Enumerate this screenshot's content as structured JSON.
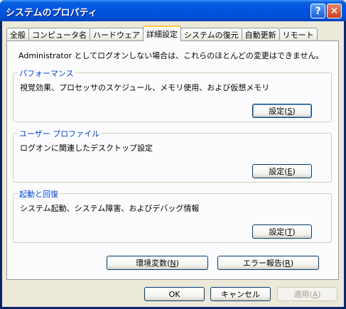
{
  "window": {
    "title": "システムのプロパティ",
    "help_glyph": "?",
    "close_glyph": "✕"
  },
  "tabs": [
    {
      "label": "全般"
    },
    {
      "label": "コンピュータ名"
    },
    {
      "label": "ハードウェア"
    },
    {
      "label": "詳細設定",
      "active": true
    },
    {
      "label": "システムの復元"
    },
    {
      "label": "自動更新"
    },
    {
      "label": "リモート"
    }
  ],
  "panel": {
    "note": "Administrator としてログオンしない場合は、これらのほとんどの変更はできません。",
    "performance": {
      "title": "パフォーマンス",
      "desc": "視覚効果、プロセッサのスケジュール、メモリ使用、および仮想メモリ",
      "button_text": "設定(",
      "button_key": "S",
      "button_close": ")"
    },
    "profile": {
      "title": "ユーザー プロファイル",
      "desc": "ログオンに関連したデスクトップ設定",
      "button_text": "設定(",
      "button_key": "E",
      "button_close": ")"
    },
    "startup": {
      "title": "起動と回復",
      "desc": "システム起動、システム障害、およびデバッグ情報",
      "button_text": "設定(",
      "button_key": "T",
      "button_close": ")"
    },
    "env_button": {
      "text": "環境変数(",
      "key": "N",
      "close": ")"
    },
    "error_button": {
      "text": "エラー報告(",
      "key": "R",
      "close": ")"
    }
  },
  "footer": {
    "ok": "OK",
    "cancel": "キャンセル",
    "apply_text": "適用(",
    "apply_key": "A",
    "apply_close": ")"
  }
}
